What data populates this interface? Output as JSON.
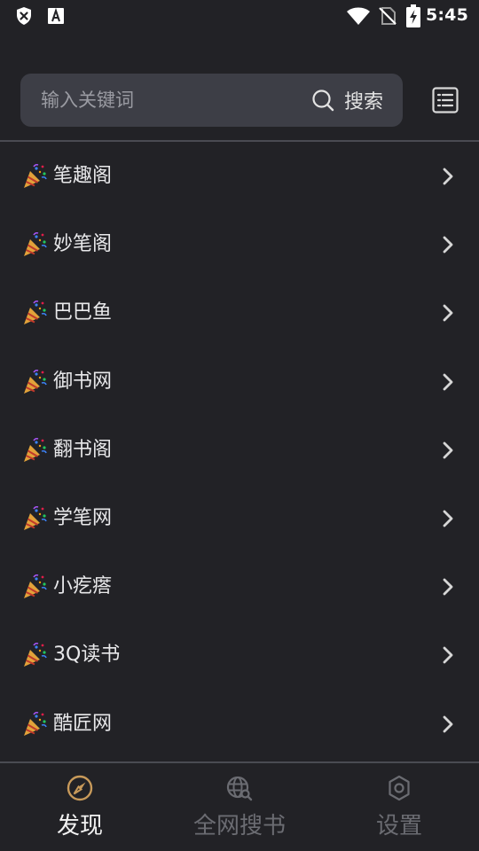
{
  "status_bar": {
    "time": "5:45"
  },
  "search": {
    "placeholder": "输入关键词",
    "button_label": "搜索"
  },
  "sources": [
    {
      "label": "笔趣阁"
    },
    {
      "label": "妙笔阁"
    },
    {
      "label": "巴巴鱼"
    },
    {
      "label": "御书网"
    },
    {
      "label": "翻书阁"
    },
    {
      "label": "学笔网"
    },
    {
      "label": "小疙瘩"
    },
    {
      "label": "3Q读书"
    },
    {
      "label": "酷匠网"
    }
  ],
  "bottom_nav": {
    "tabs": [
      {
        "label": "发现",
        "icon": "compass-icon",
        "active": true
      },
      {
        "label": "全网搜书",
        "icon": "globe-search-icon",
        "active": false
      },
      {
        "label": "设置",
        "icon": "gear-icon",
        "active": false
      }
    ]
  },
  "colors": {
    "background": "#222226",
    "search_box": "#3d3e46",
    "active_nav_icon": "#c89a5a",
    "inactive_nav": "#6b6c72"
  }
}
